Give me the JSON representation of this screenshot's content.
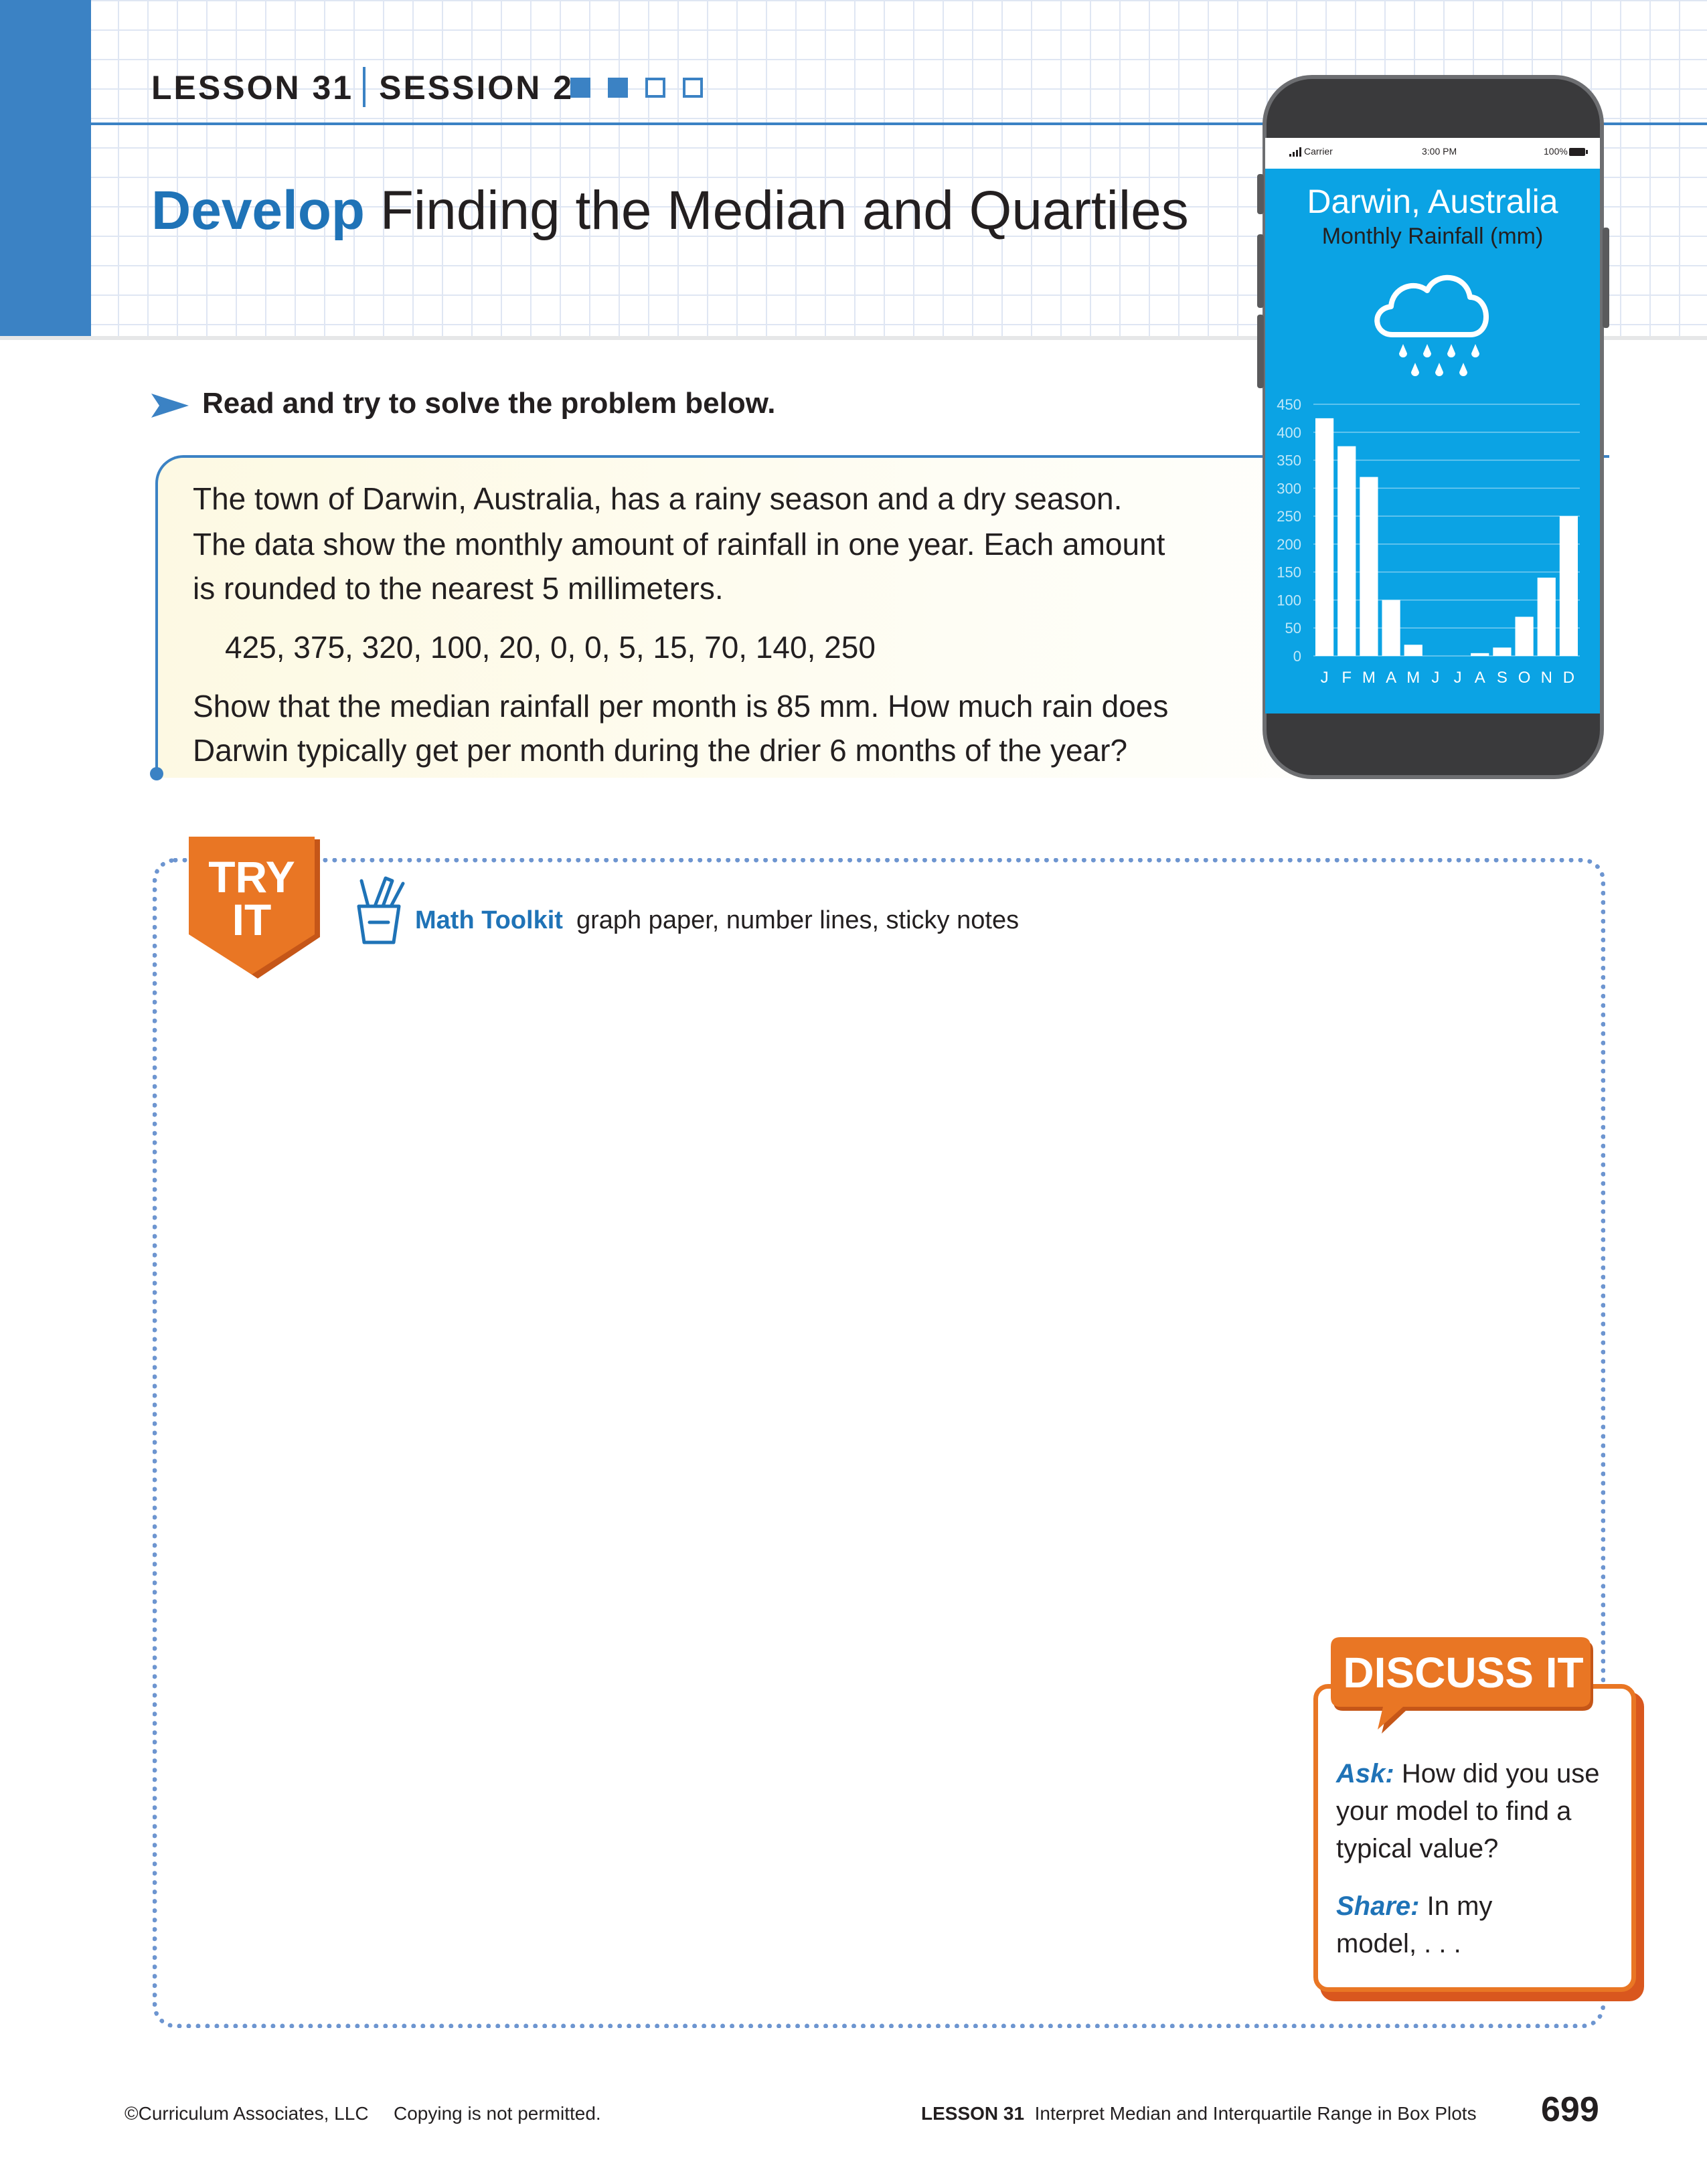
{
  "header": {
    "lesson": "LESSON 31",
    "session": "SESSION 2",
    "progress": [
      true,
      true,
      false,
      false
    ],
    "title_bold": "Develop",
    "title_rest": " Finding the Median and Quartiles"
  },
  "instruction": "Read and try to solve the problem below.",
  "problem": {
    "line1": "The town of Darwin, Australia, has a rainy season and a dry season.",
    "line2": "The data show the monthly amount of rainfall in one year. Each amount",
    "line3": "is rounded to the nearest 5 millimeters.",
    "data": "425,  375,  320,  100,  20,  0,  0,  5,  15,  70,  140,  250",
    "question1": "Show that the median rainfall per month is 85 mm. How much rain does",
    "question2": "Darwin typically get per month during the drier 6 months of the year?"
  },
  "phone": {
    "status_left": "Carrier",
    "status_time": "3:00 PM",
    "status_battery": "100%",
    "city": "Darwin, Australia",
    "subtitle": "Monthly Rainfall (mm)",
    "icon": "rain-cloud-icon"
  },
  "chart_data": {
    "type": "bar",
    "title": "Darwin, Australia",
    "subtitle": "Monthly Rainfall (mm)",
    "categories": [
      "J",
      "F",
      "M",
      "A",
      "M",
      "J",
      "J",
      "A",
      "S",
      "O",
      "N",
      "D"
    ],
    "values": [
      425,
      375,
      320,
      100,
      20,
      0,
      0,
      5,
      15,
      70,
      140,
      250
    ],
    "yticks": [
      0,
      50,
      100,
      150,
      200,
      250,
      300,
      350,
      400,
      450
    ],
    "ylim": [
      0,
      450
    ],
    "grid": true,
    "bar_color": "#ffffff",
    "background": "#0ba3e4"
  },
  "try_it": {
    "badge_line1": "TRY",
    "badge_line2": "IT",
    "toolkit_label": "Math Toolkit",
    "toolkit_items": "graph paper, number lines, sticky notes"
  },
  "discuss": {
    "title": "DISCUSS IT",
    "ask_label": "Ask:",
    "ask_line1": " How did you use",
    "ask_line2": "your model to find a",
    "ask_line3": "typical value?",
    "share_label": "Share:",
    "share_line1": " In my",
    "share_line2": "model, . . ."
  },
  "footer": {
    "copyright": "©Curriculum Associates, LLC",
    "copying": "Copying is not permitted.",
    "lesson_bold": "LESSON 31",
    "lesson_title": "Interpret Median and Interquartile Range in Box Plots",
    "page": "699"
  },
  "colors": {
    "brand_blue": "#1f73b7",
    "accent_orange": "#e97624",
    "screen_blue": "#0ba3e4"
  }
}
